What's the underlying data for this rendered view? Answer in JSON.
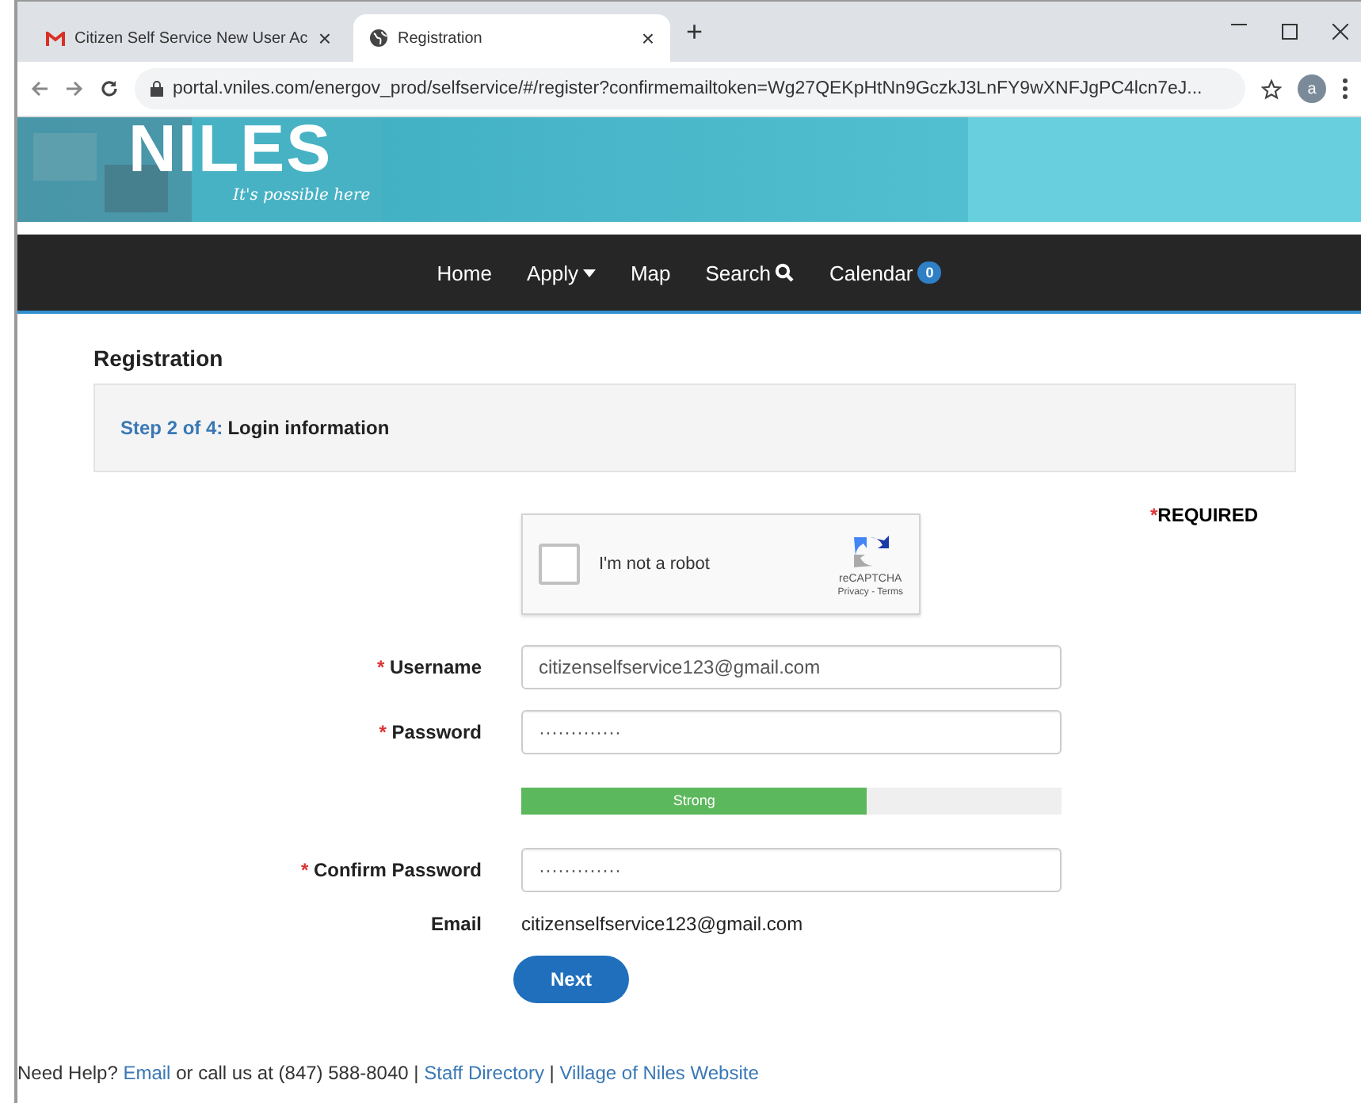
{
  "browser": {
    "tabs": [
      {
        "title": "Citizen Self Service New User Ac",
        "selected": false,
        "close": "×"
      },
      {
        "title": "Registration",
        "selected": true,
        "close": "×"
      }
    ],
    "new_tab": "+",
    "url": "portal.vniles.com/energov_prod/selfservice/#/register?confirmemailtoken=Wg27QEKpHtNn9GczkJ3LnFY9wXNFJgPC4lcn7eJ...",
    "profile": "a"
  },
  "banner": {
    "logo": "NILES",
    "tagline": "It's possible here"
  },
  "nav": [
    {
      "label": "Home",
      "kind": "link"
    },
    {
      "label": "Apply",
      "kind": "dropdown"
    },
    {
      "label": "Map",
      "kind": "link"
    },
    {
      "label": "Search",
      "kind": "search"
    },
    {
      "label": "Calendar",
      "kind": "count",
      "count": "0"
    }
  ],
  "page": {
    "title": "Registration",
    "step": "Step 2 of 4:",
    "step_name": "Login information",
    "required_mark": "*",
    "required": "REQUIRED"
  },
  "captcha": {
    "label": "I'm not a robot",
    "checked": false,
    "brand": "reCAPTCHA",
    "links": "Privacy - Terms"
  },
  "fields": [
    {
      "kind": "input",
      "label": "Username",
      "required": true,
      "value": "citizenselfservice123@gmail.com"
    },
    {
      "kind": "input",
      "label": "Password",
      "required": true,
      "value": "·············"
    },
    {
      "kind": "meter",
      "level": 0.64,
      "reading": "Strong"
    },
    {
      "kind": "input",
      "label": "Confirm Password",
      "required": true,
      "value": "·············"
    },
    {
      "kind": "text",
      "label": "Email",
      "required": false,
      "value": "citizenselfservice123@gmail.com"
    }
  ],
  "next_button": "Next",
  "footer": {
    "lead": "Need Help?",
    "email_link": "Email",
    "middle": "or call us at (847) 588-8040 |",
    "staff_link": "Staff Directory",
    "sep": "|",
    "site_link": "Village of Niles Website"
  }
}
